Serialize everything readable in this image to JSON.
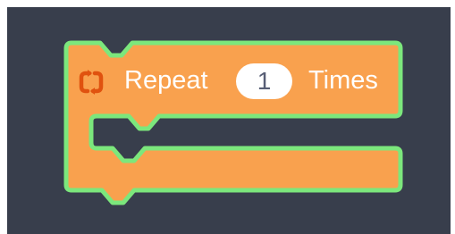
{
  "workspace": {
    "background_color": "#383e4c"
  },
  "repeat_block": {
    "icon": "loop-arrows-icon",
    "label": "Repeat",
    "count_value": "1",
    "suffix_label": "Times",
    "fill_color": "#f9a14e",
    "outline_color": "#7ce77c",
    "icon_color": "#e0520f"
  }
}
